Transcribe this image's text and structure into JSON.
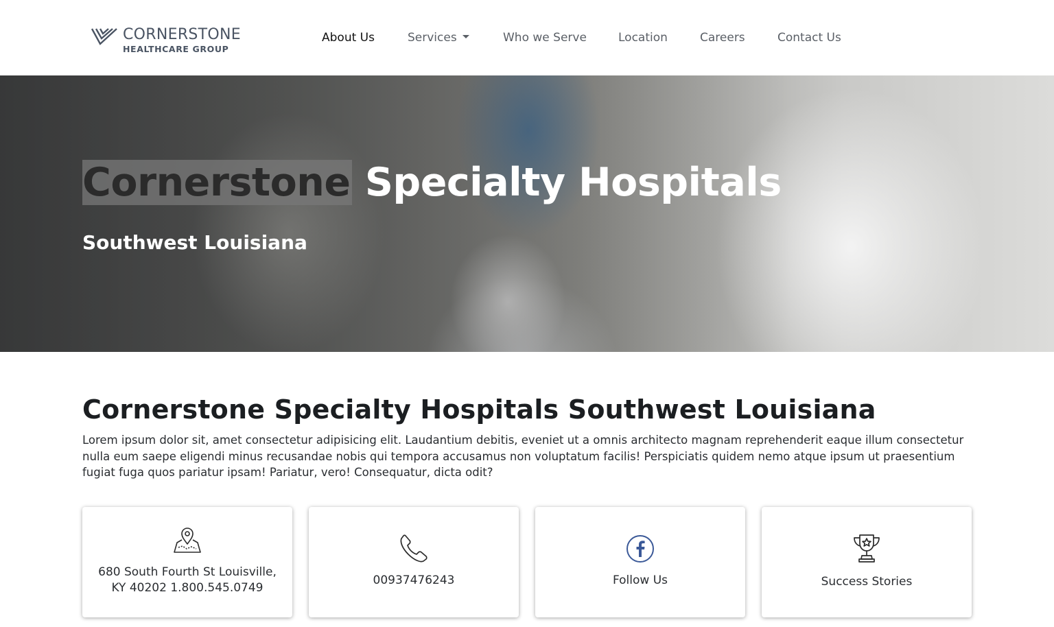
{
  "brand": {
    "name": "CORNERSTONE",
    "sub": "HEALTHCARE GROUP",
    "color": "#4a5463"
  },
  "nav": {
    "items": [
      {
        "label": "About Us",
        "active": true
      },
      {
        "label": "Services",
        "dropdown": true
      },
      {
        "label": "Who we Serve"
      },
      {
        "label": "Location"
      },
      {
        "label": "Careers"
      },
      {
        "label": "Contact Us"
      }
    ]
  },
  "hero": {
    "title_highlight": "Cornerstone",
    "title_rest": " Specialty Hospitals",
    "subtitle": "Southwest Louisiana"
  },
  "content": {
    "heading": "Cornerstone Specialty Hospitals Southwest Louisiana",
    "body": "Lorem ipsum dolor sit, amet consectetur adipisicing elit. Laudantium debitis, eveniet ut a omnis architecto magnam reprehenderit eaque illum consectetur nulla eum saepe eligendi minus recusandae nobis qui tempora accusamus non voluptatum facilis! Perspiciatis quidem nemo atque ipsum ut praesentium fugiat fuga quos pariatur ipsam! Pariatur, vero! Consequatur, dicta odit?"
  },
  "cards": [
    {
      "icon": "map-pin-icon",
      "text": "680 South Fourth St Louisville, KY 40202 1.800.545.0749"
    },
    {
      "icon": "phone-icon",
      "text": "00937476243"
    },
    {
      "icon": "facebook-icon",
      "text": "Follow Us"
    },
    {
      "icon": "trophy-icon",
      "text": "Success Stories"
    }
  ],
  "colors": {
    "facebook": "#3b5998",
    "text_dark": "#1b1e21"
  }
}
